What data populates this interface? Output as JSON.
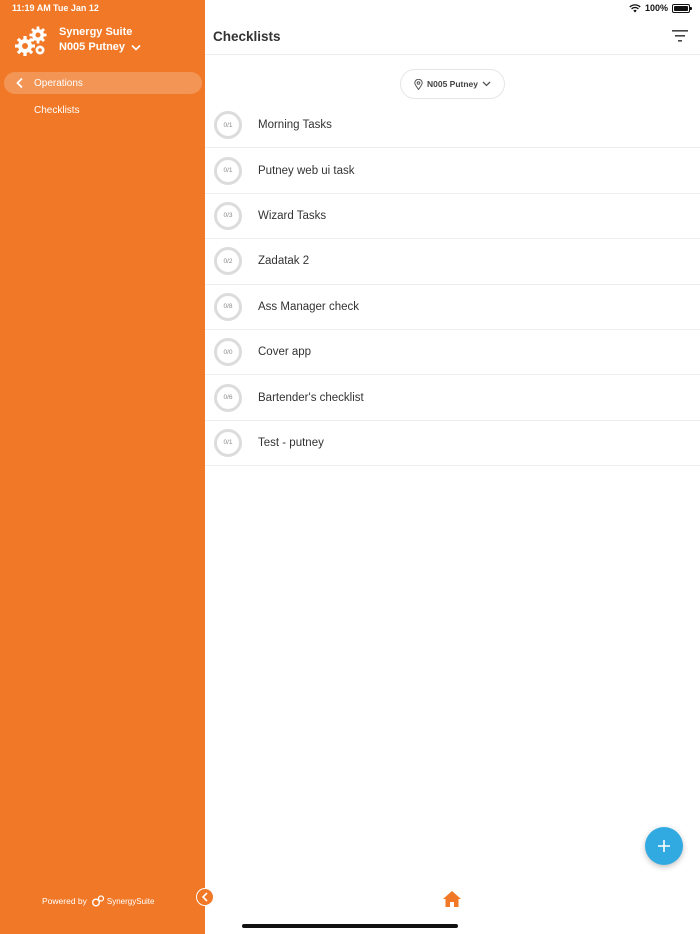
{
  "status_bar": {
    "time": "11:19 AM",
    "date": "Tue Jan 12",
    "battery": "100%"
  },
  "sidebar": {
    "app_name": "Synergy Suite",
    "location": "N005 Putney",
    "section": "Operations",
    "items": [
      {
        "label": "Checklists"
      }
    ],
    "powered_by": "Powered by",
    "powered_brand": "SynergySuite"
  },
  "header": {
    "title": "Checklists"
  },
  "location_filter": {
    "label": "N005 Putney"
  },
  "checklists": [
    {
      "progress": "0/1",
      "name": "Morning Tasks"
    },
    {
      "progress": "0/1",
      "name": "Putney web ui task"
    },
    {
      "progress": "0/3",
      "name": "Wizard Tasks"
    },
    {
      "progress": "0/2",
      "name": "Zadatak 2"
    },
    {
      "progress": "0/8",
      "name": "Ass Manager check"
    },
    {
      "progress": "0/0",
      "name": "Cover app"
    },
    {
      "progress": "0/6",
      "name": "Bartender's checklist"
    },
    {
      "progress": "0/1",
      "name": "Test - putney"
    }
  ],
  "colors": {
    "brand_orange": "#f07826",
    "fab_blue": "#31a9e1"
  },
  "icons": [
    "gear-logo-icon",
    "chevron-down-icon",
    "chevron-left-icon",
    "filter-icon",
    "location-pin-icon",
    "plus-icon",
    "home-icon",
    "wifi-icon",
    "battery-icon"
  ]
}
